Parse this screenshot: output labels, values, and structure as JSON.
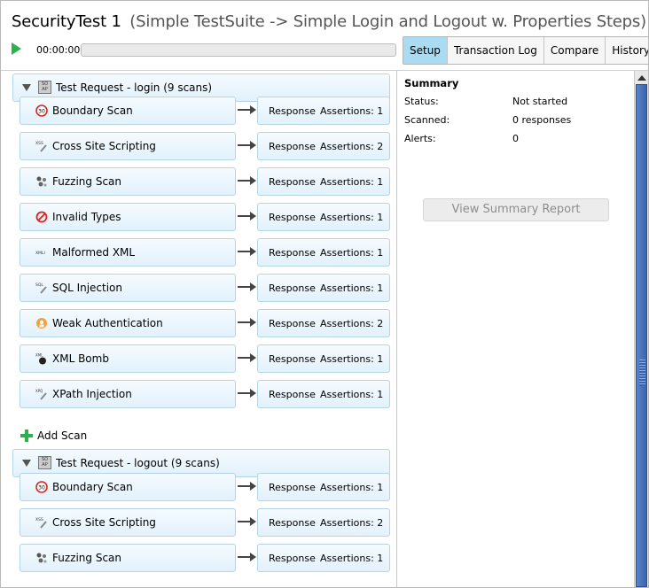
{
  "title": {
    "main": "SecurityTest 1",
    "sub": "(Simple TestSuite -> Simple Login and Logout w. Properties Steps)"
  },
  "toolbar": {
    "timer": "00:00:00",
    "progress": 0
  },
  "tabs": [
    "Setup",
    "Transaction Log",
    "Compare",
    "History"
  ],
  "groups": [
    {
      "label": "Test Request - login (9 scans)",
      "scans": [
        {
          "label": "Boundary Scan",
          "icon": "boundary-icon",
          "resp": "Response",
          "assert": "Assertions: 1"
        },
        {
          "label": "Cross Site Scripting",
          "icon": "xss-icon",
          "resp": "Response",
          "assert": "Assertions: 2"
        },
        {
          "label": "Fuzzing Scan",
          "icon": "fuzzing-icon",
          "resp": "Response",
          "assert": "Assertions: 1"
        },
        {
          "label": "Invalid Types",
          "icon": "invalid-types-icon",
          "resp": "Response",
          "assert": "Assertions: 1"
        },
        {
          "label": "Malformed XML",
          "icon": "malformed-xml-icon",
          "resp": "Response",
          "assert": "Assertions: 1"
        },
        {
          "label": "SQL Injection",
          "icon": "sql-injection-icon",
          "resp": "Response",
          "assert": "Assertions: 1"
        },
        {
          "label": "Weak Authentication",
          "icon": "weak-auth-icon",
          "resp": "Response",
          "assert": "Assertions: 2"
        },
        {
          "label": "XML Bomb",
          "icon": "xml-bomb-icon",
          "resp": "Response",
          "assert": "Assertions: 1"
        },
        {
          "label": "XPath Injection",
          "icon": "xpath-icon",
          "resp": "Response",
          "assert": "Assertions: 1"
        }
      ]
    },
    {
      "label": "Test Request - logout (9 scans)",
      "scans": [
        {
          "label": "Boundary Scan",
          "icon": "boundary-icon",
          "resp": "Response",
          "assert": "Assertions: 1"
        },
        {
          "label": "Cross Site Scripting",
          "icon": "xss-icon",
          "resp": "Response",
          "assert": "Assertions: 2"
        },
        {
          "label": "Fuzzing Scan",
          "icon": "fuzzing-icon",
          "resp": "Response",
          "assert": "Assertions: 1"
        }
      ]
    }
  ],
  "add_scan": "Add Scan",
  "summary": {
    "title": "Summary",
    "rows": [
      {
        "key": "Status:",
        "value": "Not started"
      },
      {
        "key": "Scanned:",
        "value": "0 responses"
      },
      {
        "key": "Alerts:",
        "value": "0"
      }
    ],
    "report_button": "View Summary Report"
  },
  "colors": {
    "accent_tab": "#a9dcf3",
    "play": "#2bb24c",
    "scrollbar": "#3a64b1"
  }
}
